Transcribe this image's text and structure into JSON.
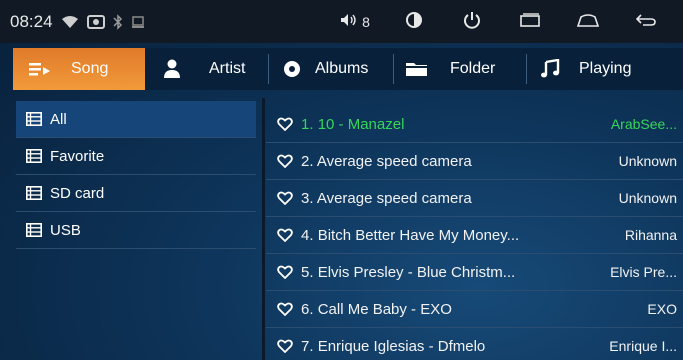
{
  "statusbar": {
    "time": "08:24",
    "volume_level": "8",
    "icons": [
      "wifi-icon",
      "image-icon",
      "bluetooth-icon",
      "storage-icon",
      "volume-icon",
      "brightness-icon",
      "power-icon",
      "recent-apps-icon",
      "home-icon",
      "back-icon"
    ]
  },
  "tabs": [
    {
      "label": "Song",
      "icon": "song-list-icon",
      "active": true
    },
    {
      "label": "Artist",
      "icon": "artist-icon",
      "active": false
    },
    {
      "label": "Albums",
      "icon": "album-icon",
      "active": false
    },
    {
      "label": "Folder",
      "icon": "folder-icon",
      "active": false
    },
    {
      "label": "Playing",
      "icon": "music-note-icon",
      "active": false
    }
  ],
  "sources": [
    {
      "label": "All",
      "active": true
    },
    {
      "label": "Favorite",
      "active": false
    },
    {
      "label": "SD card",
      "active": false
    },
    {
      "label": "USB",
      "active": false
    }
  ],
  "songs": [
    {
      "index": "1.",
      "title": "10 - Manazel",
      "artist": "ArabSee...",
      "playing": true
    },
    {
      "index": "2.",
      "title": "Average speed camera",
      "artist": "Unknown",
      "playing": false
    },
    {
      "index": "3.",
      "title": "Average speed camera",
      "artist": "Unknown",
      "playing": false
    },
    {
      "index": "4.",
      "title": "Bitch Better Have My Money...",
      "artist": "Rihanna",
      "playing": false
    },
    {
      "index": "5.",
      "title": "Elvis Presley - Blue Christm...",
      "artist": "Elvis Pre...",
      "playing": false
    },
    {
      "index": "6.",
      "title": "Call Me Baby - EXO",
      "artist": "EXO",
      "playing": false
    },
    {
      "index": "7.",
      "title": "Enrique Iglesias - Dfmelo",
      "artist": "Enrique I...",
      "playing": false
    }
  ],
  "colors": {
    "accent": "#f0922f",
    "playing": "#35d65a",
    "selected": "#154579"
  }
}
